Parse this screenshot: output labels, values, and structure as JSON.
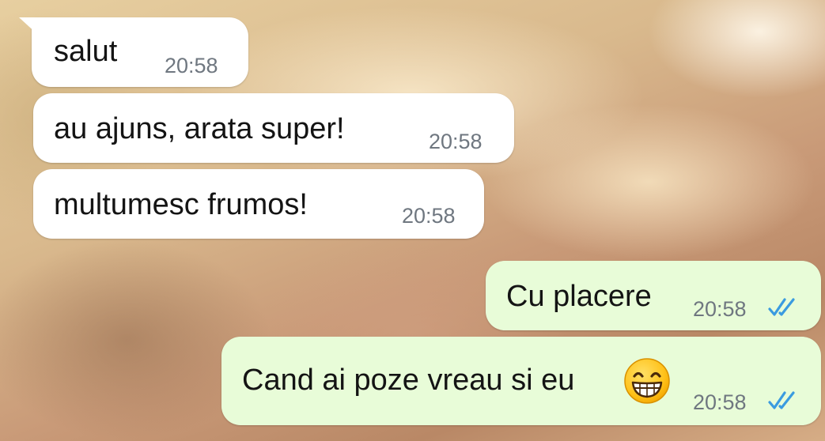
{
  "messages": [
    {
      "direction": "incoming",
      "text": "salut",
      "time": "20:58"
    },
    {
      "direction": "incoming",
      "text": "au ajuns, arata super!",
      "time": "20:58"
    },
    {
      "direction": "incoming",
      "text": "multumesc frumos!",
      "time": "20:58"
    },
    {
      "direction": "outgoing",
      "text": "Cu placere",
      "time": "20:58",
      "status": "read"
    },
    {
      "direction": "outgoing",
      "text": "Cand ai poze vreau si eu",
      "time": "20:58",
      "status": "read",
      "emoji": "grinning-face-with-smiling-eyes"
    }
  ],
  "colors": {
    "incoming_bubble": "#ffffff",
    "outgoing_bubble": "#e8fcd8",
    "read_check": "#3a9be0",
    "time_text": "#6f7780"
  }
}
